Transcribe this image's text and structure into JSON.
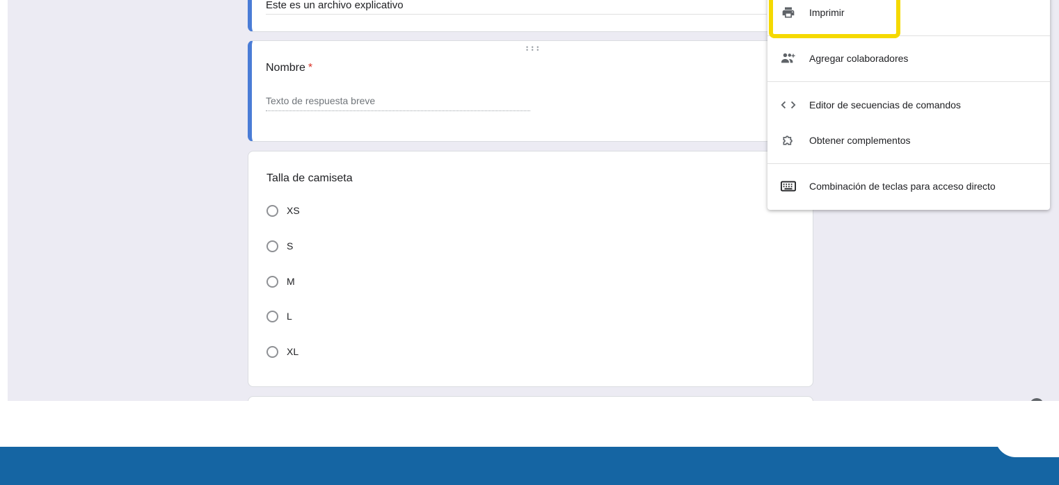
{
  "form": {
    "description": "Este es un archivo explicativo",
    "name_question": {
      "title": "Nombre",
      "required_mark": "*",
      "placeholder": "Texto de respuesta breve"
    },
    "shirt_question": {
      "title": "Talla de camiseta",
      "options": [
        "XS",
        "S",
        "M",
        "L",
        "XL"
      ]
    }
  },
  "menu": {
    "items": [
      {
        "label": "Imprimir",
        "icon": "printer-icon"
      },
      {
        "label": "Agregar colaboradores",
        "icon": "add-people-icon"
      },
      {
        "label": "Editor de secuencias de comandos",
        "icon": "code-icon"
      },
      {
        "label": "Obtener complementos",
        "icon": "puzzle-icon"
      },
      {
        "label": "Combinación de teclas para acceso directo",
        "icon": "keyboard-icon"
      }
    ]
  },
  "colors": {
    "accent": "#4a7cd6",
    "highlight": "#f5d900",
    "footer": "#1565a3",
    "required": "#d93025"
  }
}
